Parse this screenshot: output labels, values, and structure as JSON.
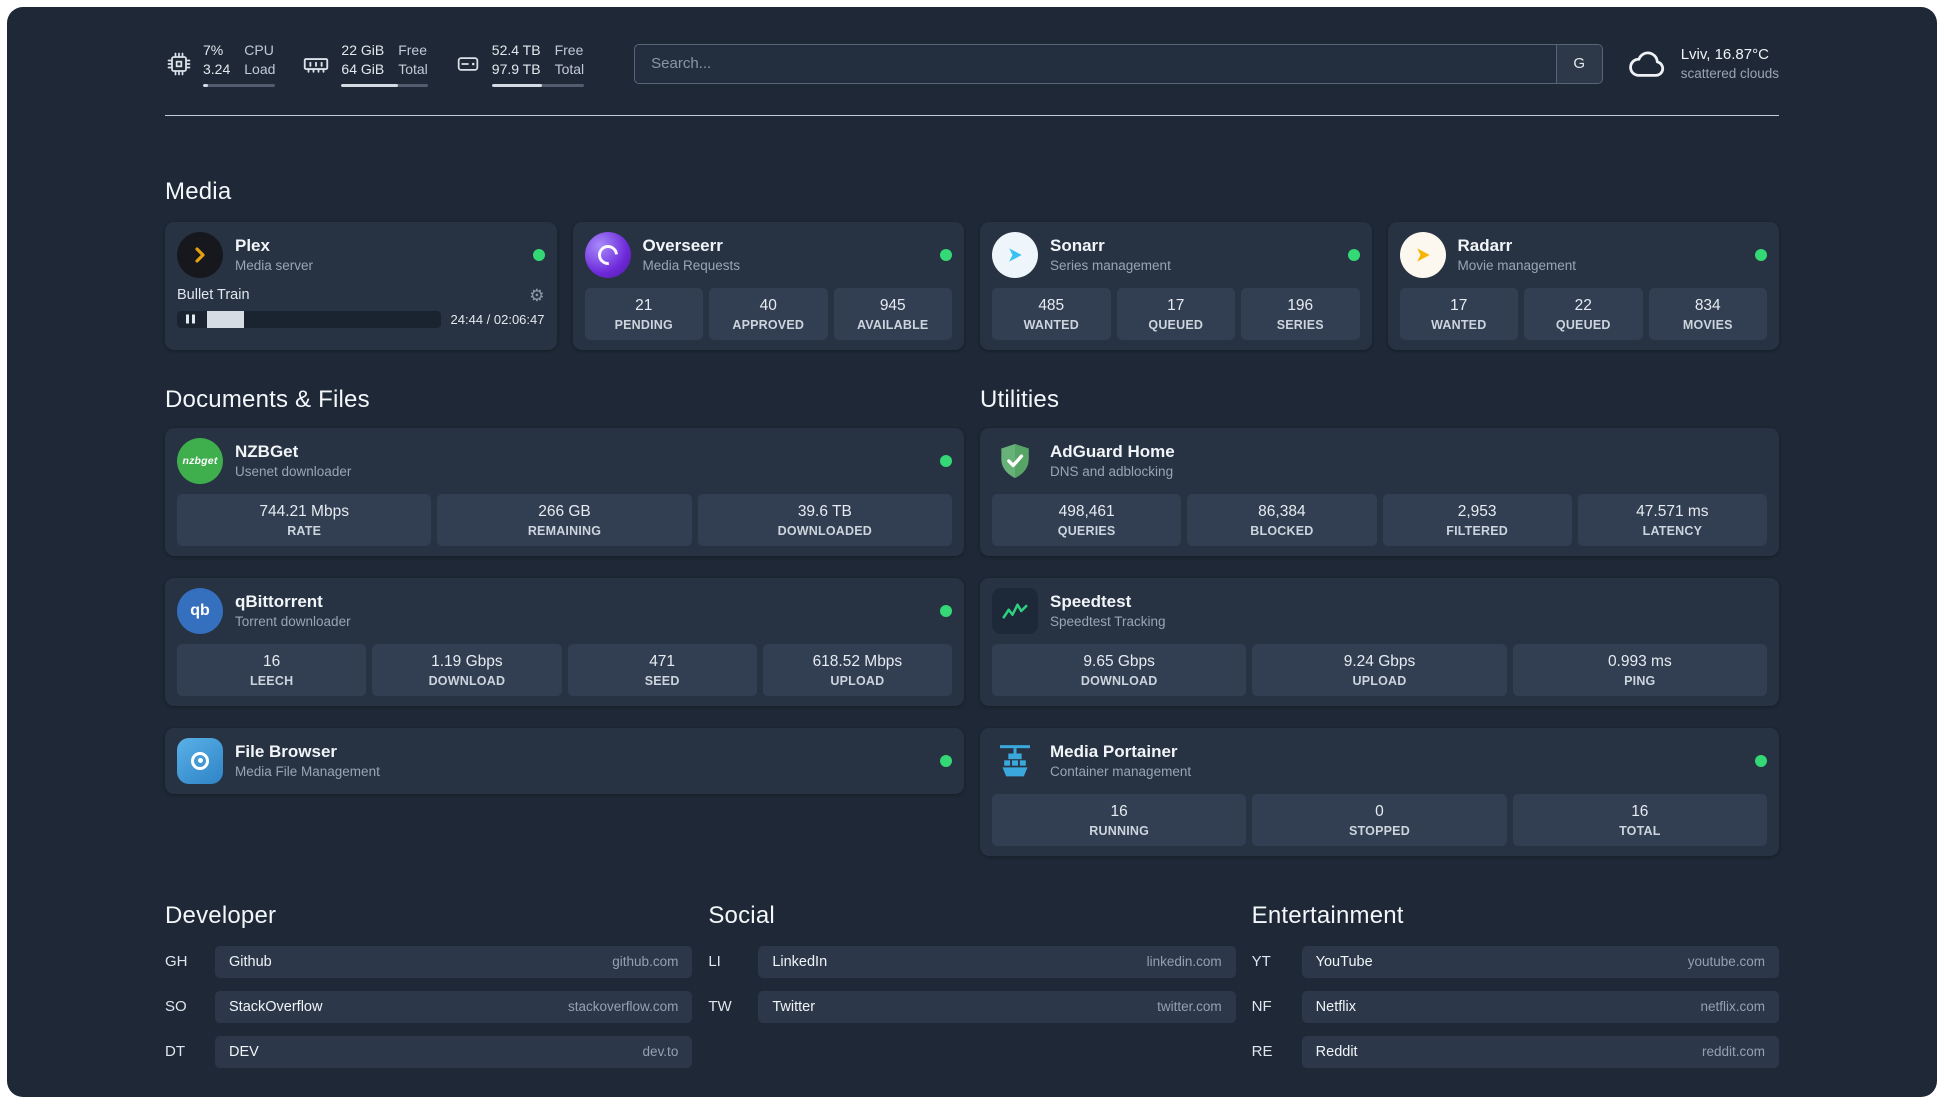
{
  "colors": {
    "status_online": "#34d874"
  },
  "topbar": {
    "cpu": {
      "icon": "cpu-icon",
      "value_top": "7%",
      "value_bottom": "3.24",
      "label_top": "CPU",
      "label_bottom": "Load",
      "bar_pct": 7
    },
    "memory": {
      "icon": "memory-icon",
      "value_top": "22 GiB",
      "value_bottom": "64 GiB",
      "label_top": "Free",
      "label_bottom": "Total",
      "bar_pct": 66
    },
    "disk": {
      "icon": "disk-icon",
      "value_top": "52.4 TB",
      "value_bottom": "97.9 TB",
      "label_top": "Free",
      "label_bottom": "Total",
      "bar_pct": 54
    },
    "search": {
      "placeholder": "Search...",
      "provider_label": "G"
    },
    "weather": {
      "icon": "cloud-icon",
      "location": "Lviv, 16.87°C",
      "condition": "scattered clouds"
    }
  },
  "sections": {
    "media": {
      "title": "Media",
      "cards": [
        {
          "id": "plex",
          "icon": "plex-icon",
          "name": "Plex",
          "subtitle": "Media server",
          "online": true,
          "player": {
            "title": "Bullet Train",
            "time": "24:44 / 02:06:47",
            "progress_pct": 14
          }
        },
        {
          "id": "overseerr",
          "icon": "overseerr-icon",
          "name": "Overseerr",
          "subtitle": "Media Requests",
          "online": true,
          "stats": [
            {
              "value": "21",
              "label": "PENDING"
            },
            {
              "value": "40",
              "label": "APPROVED"
            },
            {
              "value": "945",
              "label": "AVAILABLE"
            }
          ]
        },
        {
          "id": "sonarr",
          "icon": "sonarr-icon",
          "name": "Sonarr",
          "subtitle": "Series management",
          "online": true,
          "stats": [
            {
              "value": "485",
              "label": "WANTED"
            },
            {
              "value": "17",
              "label": "QUEUED"
            },
            {
              "value": "196",
              "label": "SERIES"
            }
          ]
        },
        {
          "id": "radarr",
          "icon": "radarr-icon",
          "name": "Radarr",
          "subtitle": "Movie management",
          "online": true,
          "stats": [
            {
              "value": "17",
              "label": "WANTED"
            },
            {
              "value": "22",
              "label": "QUEUED"
            },
            {
              "value": "834",
              "label": "MOVIES"
            }
          ]
        }
      ]
    },
    "documents": {
      "title": "Documents & Files",
      "cards": [
        {
          "id": "nzbget",
          "icon": "nzbget-icon",
          "name": "NZBGet",
          "subtitle": "Usenet downloader",
          "online": true,
          "stats": [
            {
              "value": "744.21 Mbps",
              "label": "RATE"
            },
            {
              "value": "266 GB",
              "label": "REMAINING"
            },
            {
              "value": "39.6 TB",
              "label": "DOWNLOADED"
            }
          ]
        },
        {
          "id": "qbittorrent",
          "icon": "qbittorrent-icon",
          "name": "qBittorrent",
          "subtitle": "Torrent downloader",
          "online": true,
          "stats": [
            {
              "value": "16",
              "label": "LEECH"
            },
            {
              "value": "1.19 Gbps",
              "label": "DOWNLOAD"
            },
            {
              "value": "471",
              "label": "SEED"
            },
            {
              "value": "618.52 Mbps",
              "label": "UPLOAD"
            }
          ]
        },
        {
          "id": "filebrowser",
          "icon": "filebrowser-icon",
          "name": "File Browser",
          "subtitle": "Media File Management",
          "online": true
        }
      ]
    },
    "utilities": {
      "title": "Utilities",
      "cards": [
        {
          "id": "adguard",
          "icon": "adguard-icon",
          "name": "AdGuard Home",
          "subtitle": "DNS and adblocking",
          "online": false,
          "stats": [
            {
              "value": "498,461",
              "label": "QUERIES"
            },
            {
              "value": "86,384",
              "label": "BLOCKED"
            },
            {
              "value": "2,953",
              "label": "FILTERED"
            },
            {
              "value": "47.571 ms",
              "label": "LATENCY"
            }
          ]
        },
        {
          "id": "speedtest",
          "icon": "speedtest-icon",
          "name": "Speedtest",
          "subtitle": "Speedtest Tracking",
          "online": false,
          "stats": [
            {
              "value": "9.65 Gbps",
              "label": "DOWNLOAD"
            },
            {
              "value": "9.24 Gbps",
              "label": "UPLOAD"
            },
            {
              "value": "0.993 ms",
              "label": "PING"
            }
          ]
        },
        {
          "id": "portainer",
          "icon": "portainer-icon",
          "name": "Media Portainer",
          "subtitle": "Container management",
          "online": true,
          "stats": [
            {
              "value": "16",
              "label": "RUNNING"
            },
            {
              "value": "0",
              "label": "STOPPED"
            },
            {
              "value": "16",
              "label": "TOTAL"
            }
          ]
        }
      ]
    }
  },
  "bookmarks": [
    {
      "title": "Developer",
      "items": [
        {
          "abbr": "GH",
          "name": "Github",
          "url": "github.com"
        },
        {
          "abbr": "SO",
          "name": "StackOverflow",
          "url": "stackoverflow.com"
        },
        {
          "abbr": "DT",
          "name": "DEV",
          "url": "dev.to"
        }
      ]
    },
    {
      "title": "Social",
      "items": [
        {
          "abbr": "LI",
          "name": "LinkedIn",
          "url": "linkedin.com"
        },
        {
          "abbr": "TW",
          "name": "Twitter",
          "url": "twitter.com"
        }
      ]
    },
    {
      "title": "Entertainment",
      "items": [
        {
          "abbr": "YT",
          "name": "YouTube",
          "url": "youtube.com"
        },
        {
          "abbr": "NF",
          "name": "Netflix",
          "url": "netflix.com"
        },
        {
          "abbr": "RE",
          "name": "Reddit",
          "url": "reddit.com"
        }
      ]
    }
  ]
}
